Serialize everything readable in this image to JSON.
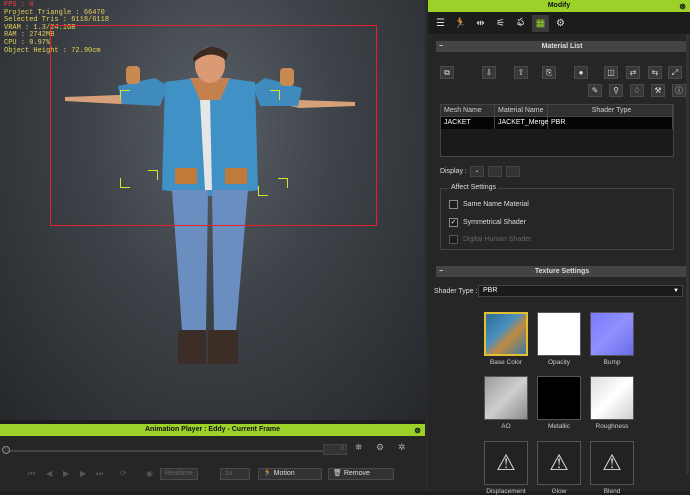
{
  "viewport": {
    "stats": [
      {
        "text": "FPS : 0",
        "red": true
      },
      {
        "text": "Project Triangle : 66470",
        "red": false
      },
      {
        "text": "Selected Tris : 6118/6118",
        "red": false
      },
      {
        "text": "VRAM : 1.3/24.1GB",
        "red": false
      },
      {
        "text": "RAM : 2742MB",
        "red": false
      },
      {
        "text": "CPU : 0.97%",
        "red": false
      },
      {
        "text": "Object Height : 72.90cm",
        "red": false
      }
    ]
  },
  "animation_player": {
    "title": "Animation Player : Eddy - Current Frame",
    "frame_value": "0",
    "realtime_label": "Realtime",
    "speed_label": "1x",
    "motion_label": "Motion",
    "remove_label": "Remove"
  },
  "modify": {
    "title": "Modify",
    "material_list_title": "Material List",
    "table": {
      "headers": [
        "Mesh Name",
        "Material Name",
        "Shader Type"
      ],
      "rows": [
        [
          "JACKET",
          "JACKET_Merge",
          "PBR"
        ]
      ]
    },
    "display_label": "Display :",
    "affect_settings": {
      "legend": "Affect Settings",
      "same_name": "Same Name Material",
      "symmetrical": "Symmetrical Shader",
      "digital_human": "Digital Human Shader",
      "symmetrical_checked": true
    },
    "texture_settings_title": "Texture Settings",
    "shader_type_label": "Shader Type :",
    "shader_type_value": "PBR",
    "textures": [
      "Base Color",
      "Opacity",
      "Bump",
      "AO",
      "Metallic",
      "Roughness",
      "Displacement",
      "Glow",
      "Blend"
    ]
  },
  "colors": {
    "accent": "#9cd12a",
    "selection": "#e8202a",
    "stats": "#e6d25a"
  }
}
